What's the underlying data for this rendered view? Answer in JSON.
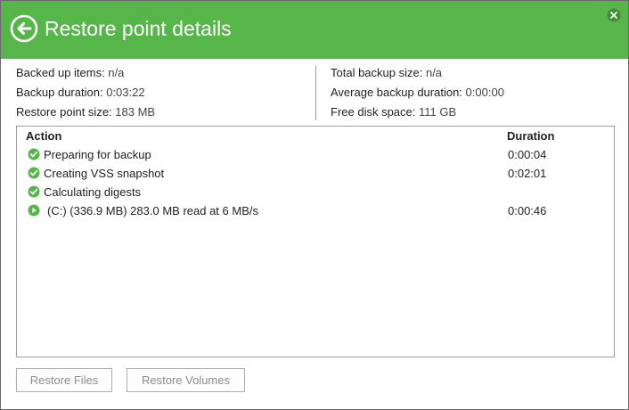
{
  "header": {
    "title": "Restore point details",
    "color": "#57b649"
  },
  "summary": {
    "left": [
      {
        "label": "Backed up items:",
        "value": "n/a"
      },
      {
        "label": "Backup duration:",
        "value": "0:03:22"
      },
      {
        "label": "Restore point size:",
        "value": "183 MB"
      }
    ],
    "right": [
      {
        "label": "Total backup size:",
        "value": "n/a"
      },
      {
        "label": "Average backup duration:",
        "value": "0:00:00"
      },
      {
        "label": "Free disk space:",
        "value": "111 GB"
      }
    ]
  },
  "table": {
    "headers": {
      "action": "Action",
      "duration": "Duration"
    },
    "rows": [
      {
        "icon": "check-circle-icon",
        "action": "Preparing for backup",
        "duration": "0:00:04"
      },
      {
        "icon": "check-circle-icon",
        "action": "Creating VSS snapshot",
        "duration": "0:02:01"
      },
      {
        "icon": "check-circle-icon",
        "action": "Calculating digests",
        "duration": ""
      },
      {
        "icon": "play-circle-icon",
        "action": "(C:) (336.9 MB) 283.0 MB read at 6 MB/s",
        "duration": "0:00:46"
      }
    ]
  },
  "buttons": {
    "restore_files": "Restore Files",
    "restore_volumes": "Restore Volumes"
  }
}
